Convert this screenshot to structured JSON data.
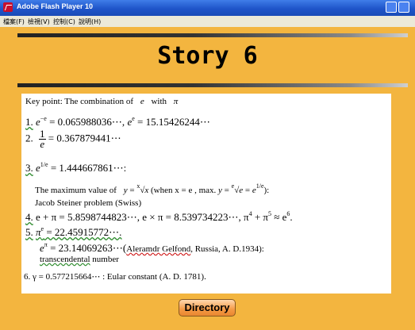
{
  "window": {
    "title": "Adobe Flash Player 10"
  },
  "menu": [
    "檔案(F)",
    "檢視(V)",
    "控制(C)",
    "說明(H)"
  ],
  "page": {
    "title": "Story 6"
  },
  "content": {
    "key_point": {
      "text": "Key point: The combination of",
      "e": "e",
      "with": "with",
      "pi": "π"
    },
    "item1": {
      "num": "1.",
      "part1": " = 0.065988036⋯, ",
      "part2": " = 15.15426244⋯"
    },
    "item2": {
      "num": "2.",
      "value": " = 0.367879441⋯"
    },
    "item3": {
      "num": "3.",
      "value": " = 1.444667861⋯:"
    },
    "max_value": {
      "text": "The maximum value of",
      "cond1": "(when x = e , max.",
      "end": "):"
    },
    "steiner": "Jacob Steiner problem (Swiss)",
    "item4": {
      "num": "4.",
      "text1": "e + π = 5.8598744823⋯, e × π = 8.539734223⋯,  π",
      "text2": " + π",
      "text3": " ≈ e",
      "end": "."
    },
    "item5": {
      "num": "5.",
      "value": " = 22.45915772⋯."
    },
    "gelfond": {
      "value": " = 23.14069263⋯(",
      "name": "Aleramdr Gelfond",
      "rest": ", Russia, A. D.1934):"
    },
    "transcendental": {
      "word": "transcendental",
      "rest": " number"
    },
    "item6": {
      "num": "6.",
      "value": "γ = 0.577215664⋯ : Eular constant (A. D. 1781)."
    }
  },
  "directory_button": "Directory",
  "colors": {
    "background": "#f3b53f",
    "content": "#ffffff",
    "title_bar": "#1f55c9",
    "button": "#f59a45"
  }
}
